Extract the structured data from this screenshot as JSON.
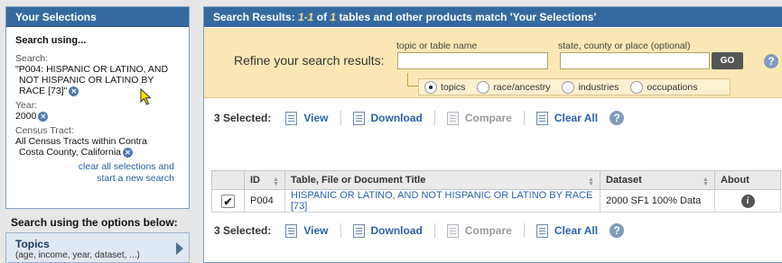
{
  "left_panel": {
    "header": "Your Selections",
    "search_using": "Search using...",
    "search_label": "Search:",
    "search_lines": [
      "\"P004: HISPANIC OR LATINO, AND",
      "NOT HISPANIC OR LATINO BY",
      "RACE [73]\""
    ],
    "year_label": "Year:",
    "year_value": "2000",
    "tract_label": "Census Tract:",
    "tract_lines": [
      "All Census Tracts within Contra",
      "Costa County, California"
    ],
    "clear_lines": [
      "clear all selections and",
      "start a new search"
    ],
    "options_heading": "Search using the options below:",
    "topics": {
      "title": "Topics",
      "subtitle": "(age, income, year, dataset, ...)"
    }
  },
  "results": {
    "header_prefix": "Search Results:",
    "range": "1-1",
    "of": "of",
    "total": "1",
    "header_suffix": "tables and other products match 'Your Selections'"
  },
  "refine": {
    "label": "Refine your search results:",
    "topic_label": "topic or table name",
    "topic_value": "",
    "geo_label": "state, county or place (optional)",
    "geo_value": "",
    "go": "GO",
    "help": "?",
    "options": [
      {
        "label": "topics",
        "selected": true
      },
      {
        "label": "race/ancestry",
        "selected": false
      },
      {
        "label": "industries",
        "selected": false
      },
      {
        "label": "occupations",
        "selected": false
      }
    ]
  },
  "toolbar": {
    "selected": "3 Selected:",
    "view": "View",
    "download": "Download",
    "compare": "Compare",
    "clear_all": "Clear All",
    "help": "?"
  },
  "table": {
    "headers": [
      "ID",
      "Table, File or Document Title",
      "Dataset",
      "About"
    ],
    "rows": [
      {
        "checked": "✔",
        "id": "P004",
        "title": "HISPANIC OR LATINO, AND NOT HISPANIC OR LATINO BY RACE [73]",
        "dataset": "2000 SF1 100% Data",
        "about": "i"
      }
    ]
  },
  "icons": {
    "remove": "close-circle-icon",
    "view": "document-view-icon",
    "download": "download-icon",
    "compare": "compare-icon",
    "clear": "clear-icon",
    "help": "help-icon",
    "info": "info-icon",
    "cursor": "mouse-pointer-icon"
  },
  "colors": {
    "header_blue": "#356aa0",
    "link_blue": "#2a63a8",
    "refine_bg": "#fbe7b5"
  }
}
